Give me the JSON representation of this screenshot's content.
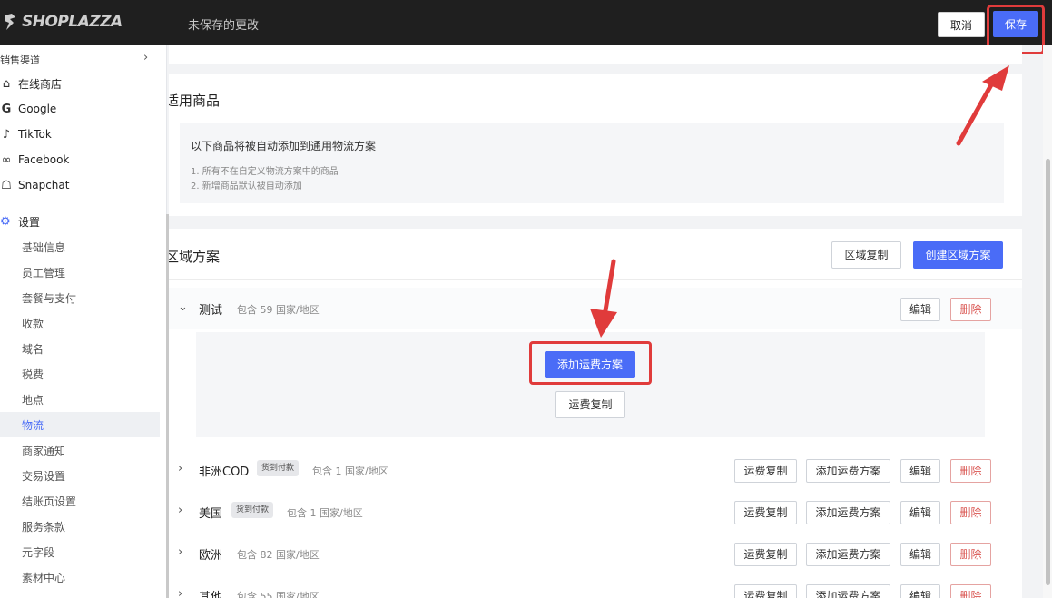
{
  "topbar": {
    "brand": "SHOPLAZZA",
    "unsaved_text": "未保存的更改",
    "cancel_label": "取消",
    "save_label": "保存"
  },
  "sidebar": {
    "section_label": "销售渠道",
    "channels": [
      {
        "label": "在线商店",
        "icon": "store-icon"
      },
      {
        "label": "Google",
        "icon": "google-icon"
      },
      {
        "label": "TikTok",
        "icon": "tiktok-icon"
      },
      {
        "label": "Facebook",
        "icon": "meta-icon"
      },
      {
        "label": "Snapchat",
        "icon": "snapchat-icon"
      }
    ],
    "settings_label": "设置",
    "settings_items": [
      "基础信息",
      "员工管理",
      "套餐与支付",
      "收款",
      "域名",
      "税费",
      "地点",
      "物流",
      "商家通知",
      "交易设置",
      "结账页设置",
      "服务条款",
      "元字段",
      "素材中心"
    ],
    "active_item": "物流"
  },
  "products_card": {
    "title": "适用商品",
    "info_main": "以下商品将被自动添加到通用物流方案",
    "info_lines": [
      "1. 所有不在自定义物流方案中的商品",
      "2. 新增商品默认被自动添加"
    ]
  },
  "zones_card": {
    "title": "区域方案",
    "copy_zone_label": "区域复制",
    "create_zone_label": "创建区域方案",
    "zones": [
      {
        "name": "测试",
        "tag": "",
        "count": "包含 59 国家/地区",
        "expanded": true
      },
      {
        "name": "非洲COD",
        "tag": "货到付款",
        "count": "包含 1 国家/地区",
        "expanded": false
      },
      {
        "name": "美国",
        "tag": "货到付款",
        "count": "包含 1 国家/地区",
        "expanded": false
      },
      {
        "name": "欧洲",
        "tag": "",
        "count": "包含 82 国家/地区",
        "expanded": false
      },
      {
        "name": "其他",
        "tag": "",
        "count": "包含 55 国家/地区",
        "expanded": false
      }
    ],
    "add_rate_label": "添加运费方案",
    "copy_rate_label": "运费复制",
    "edit_label": "编辑",
    "delete_label": "删除"
  },
  "colors": {
    "primary": "#4a6cf7",
    "highlight": "#e03b3b",
    "topbar": "#1f1f1f"
  }
}
